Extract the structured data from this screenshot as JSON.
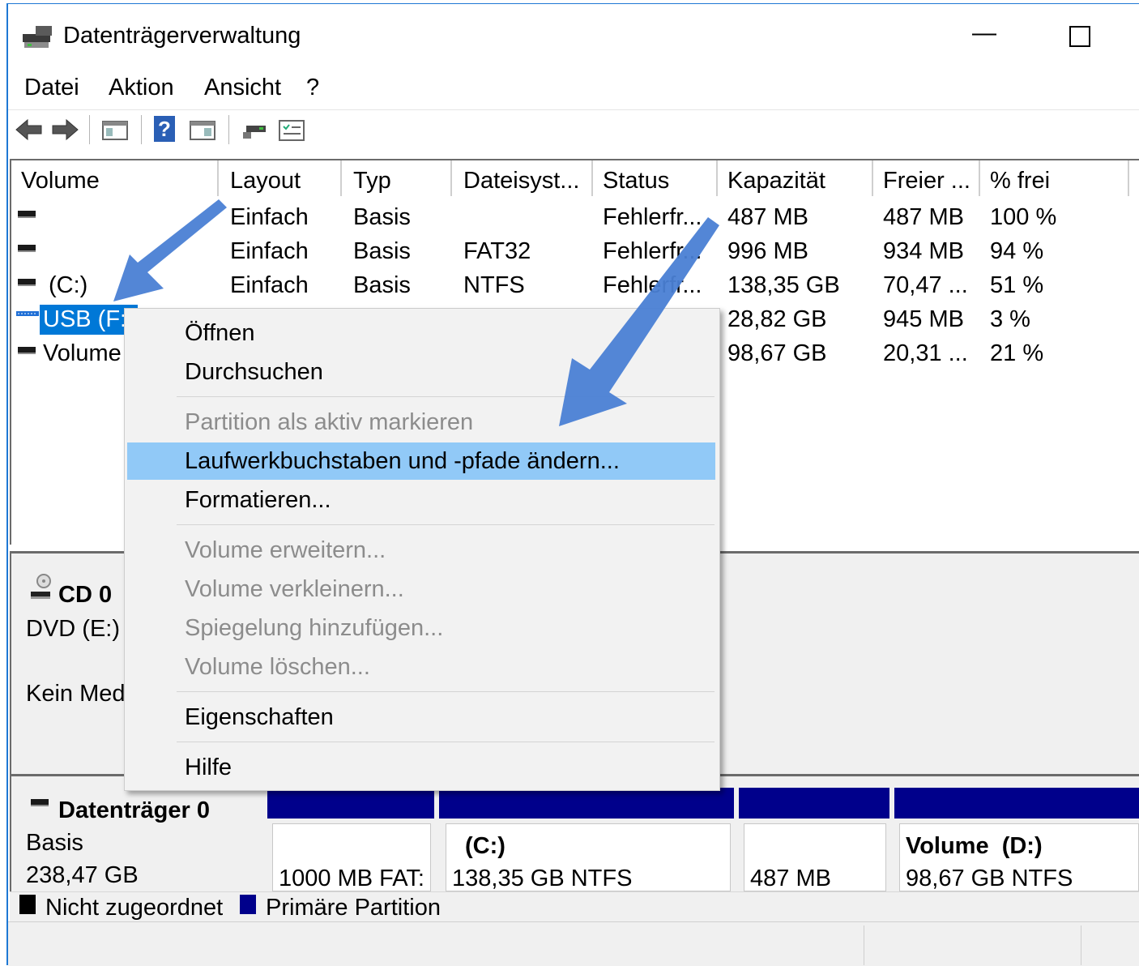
{
  "window": {
    "title": "Datenträgerverwaltung",
    "minimize_glyph": "—",
    "maximize_glyph": "☐"
  },
  "menubar": [
    "Datei",
    "Aktion",
    "Ansicht",
    "?"
  ],
  "toolbar": {
    "icons": [
      "back-arrow-icon",
      "forward-arrow-icon",
      "console-tree-icon",
      "help-icon",
      "show-pane-icon",
      "connect-icon",
      "properties-icon"
    ],
    "help_glyph": "?"
  },
  "table": {
    "headers": [
      "Volume",
      "Layout",
      "Typ",
      "Dateisyst...",
      "Status",
      "Kapazität",
      "Freier ...",
      "% frei"
    ],
    "rows": [
      {
        "volume": "",
        "layout": "Einfach",
        "typ": "Basis",
        "fs": "",
        "status": "Fehlerfr...",
        "cap": "487 MB",
        "free": "487 MB",
        "pct": "100 %"
      },
      {
        "volume": "",
        "layout": "Einfach",
        "typ": "Basis",
        "fs": "FAT32",
        "status": "Fehlerfr...",
        "cap": "996 MB",
        "free": "934 MB",
        "pct": "94 %"
      },
      {
        "volume": "(C:)",
        "layout": "Einfach",
        "typ": "Basis",
        "fs": "NTFS",
        "status": "Fehlerfr...",
        "cap": "138,35 GB",
        "free": "70,47 ...",
        "pct": "51 %"
      },
      {
        "volume": "USB (F:)",
        "layout": "",
        "typ": "",
        "fs": "",
        "status": "",
        "cap": "28,82 GB",
        "free": "945 MB",
        "pct": "3 %"
      },
      {
        "volume": "Volume",
        "layout": "",
        "typ": "",
        "fs": "",
        "status": "",
        "cap": "98,67 GB",
        "free": "20,31 ...",
        "pct": "21 %"
      }
    ]
  },
  "graph": {
    "cd": {
      "name": "CD 0",
      "type": "DVD (E:)",
      "media": "Kein Med"
    },
    "disk0": {
      "name": "Datenträger 0",
      "type": "Basis",
      "size": "238,47 GB"
    },
    "partitions": [
      {
        "title": "",
        "info": "1000 MB FAT:"
      },
      {
        "title": "(C:)",
        "info": "138,35 GB NTFS"
      },
      {
        "title": "",
        "info": "487 MB"
      },
      {
        "title": "Volume  (D:)",
        "info": "98,67 GB NTFS"
      }
    ],
    "legend": [
      {
        "label": "Nicht zugeordnet",
        "color": "#000000"
      },
      {
        "label": "Primäre Partition",
        "color": "#00008b"
      }
    ]
  },
  "context_menu": {
    "items": [
      {
        "label": "Öffnen",
        "enabled": true
      },
      {
        "label": "Durchsuchen",
        "enabled": true
      },
      {
        "label": "Partition als aktiv markieren",
        "enabled": false
      },
      {
        "label": "Laufwerkbuchstaben und -pfade ändern...",
        "enabled": true,
        "highlighted": true
      },
      {
        "label": "Formatieren...",
        "enabled": true
      },
      {
        "label": "Volume erweitern...",
        "enabled": false
      },
      {
        "label": "Volume verkleinern...",
        "enabled": false
      },
      {
        "label": "Spiegelung hinzufügen...",
        "enabled": false
      },
      {
        "label": "Volume löschen...",
        "enabled": false
      },
      {
        "label": "Eigenschaften",
        "enabled": true
      },
      {
        "label": "Hilfe",
        "enabled": true
      }
    ]
  },
  "colors": {
    "selection": "#0078d7",
    "menu_highlight": "#91c9f7",
    "primary_partition": "#00008b",
    "annotation_arrow": "#4a7fd4"
  }
}
